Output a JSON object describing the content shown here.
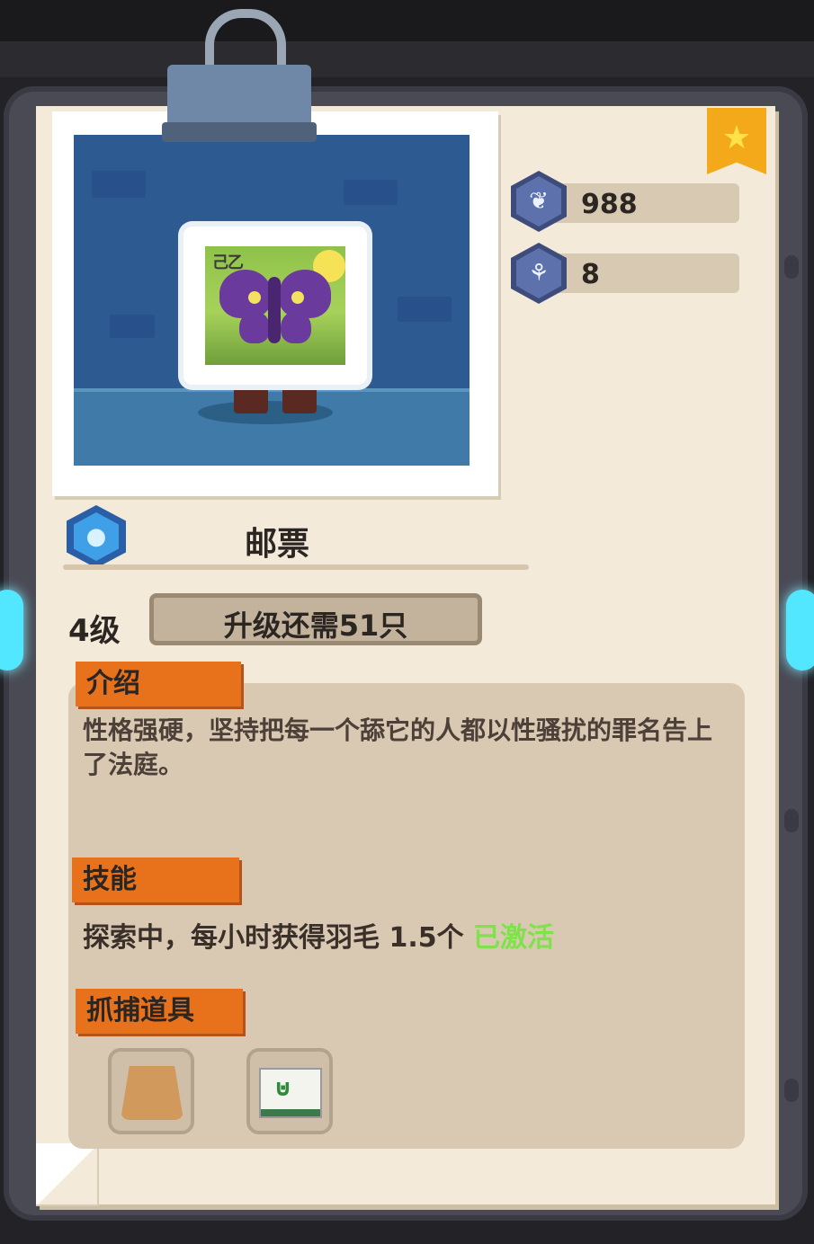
{
  "pet": {
    "name": "邮票",
    "stamp_code": "己乙",
    "level": "4级",
    "upgrade_text": "升级还需51只"
  },
  "stats": [
    {
      "icon": "feather-icon",
      "value": "988"
    },
    {
      "icon": "plant-icon",
      "value": "8"
    }
  ],
  "intro": {
    "header": "介绍",
    "text": "性格强硬，坚持把每一个舔它的人都以性骚扰的罪名告上了法庭。"
  },
  "skill": {
    "header": "技能",
    "text": "探索中，每小时获得羽毛 1.5个",
    "status": "已激活"
  },
  "tools": {
    "header": "抓捕道具",
    "items": [
      "bag-icon",
      "envelope-icon"
    ]
  },
  "colors": {
    "tag": "#e8721c",
    "active": "#7fe24a",
    "star": "#f4a91a"
  }
}
